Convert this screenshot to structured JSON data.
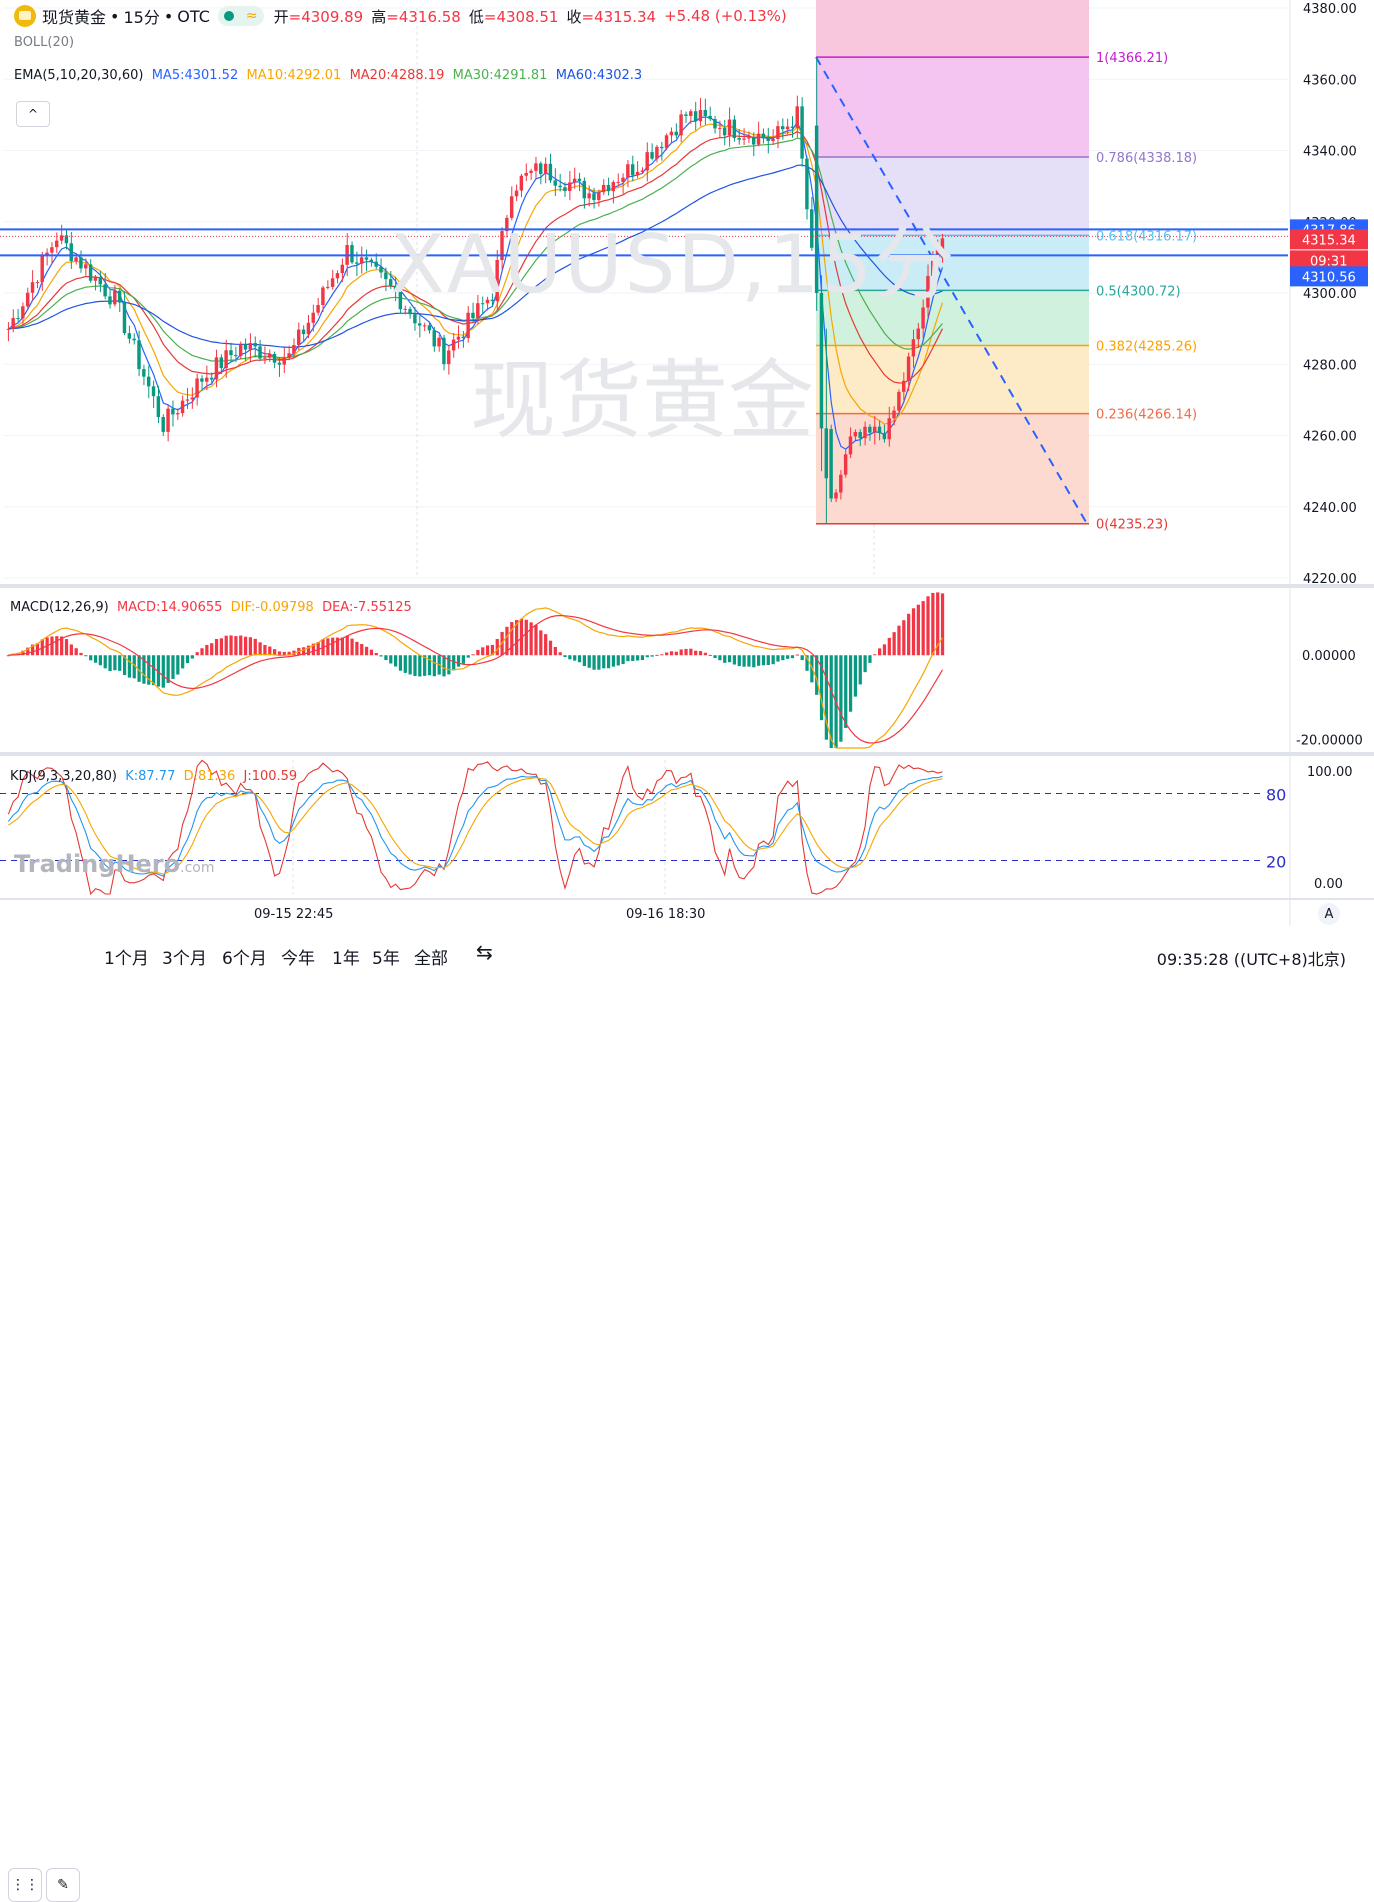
{
  "header": {
    "symbol_name": "现货黄金",
    "interval": "15分",
    "exchange": "OTC",
    "sep": "•",
    "wave_icon": "≈",
    "open_label": "开",
    "open": "=4309.89",
    "high_label": "高",
    "high": "=4316.58",
    "low_label": "低",
    "low": "=4308.51",
    "close_label": "收",
    "close": "=4315.34",
    "change": "+5.48 (+0.13%)"
  },
  "indicators": {
    "boll": "BOLL(20)",
    "ema": "EMA(5,10,20,30,60)",
    "ma5": "MA5:4301.52",
    "ma10": "MA10:4292.01",
    "ma20": "MA20:4288.19",
    "ma30": "MA30:4291.81",
    "ma60": "MA60:4302.3",
    "macd_title": "MACD(12,26,9)",
    "macd_val": "MACD:14.90655",
    "dif_val": "DIF:-0.09798",
    "dea_val": "DEA:-7.55125",
    "kdj_title": "KDJ(9,3,3,20,80)",
    "k_val": "K:87.77",
    "d_val": "D:81.36",
    "j_val": "J:100.59"
  },
  "colors": {
    "up": "#f23645",
    "down": "#089981",
    "ma5": "#2962ff",
    "ma10": "#f7a600",
    "ma20": "#e53935",
    "ma30": "#4caf50",
    "ma60": "#1e53e5",
    "macd": "#f23645",
    "dif": "#f7a600",
    "dea": "#f23645",
    "k": "#2196f3",
    "d": "#f7a600",
    "j": "#e53935"
  },
  "watermark": {
    "symbol": "XAUUSD,15分",
    "name": "现货黄金",
    "brand": "TradingHero",
    "brand_suffix": ".com"
  },
  "price_badges": {
    "p1": "4317.86",
    "p2": "4315.34",
    "countdown": "09:31",
    "p3": "4310.56"
  },
  "fib_levels": [
    {
      "label": "1(4366.21)",
      "price": 4366.21,
      "color": "#c51bd1",
      "fill": "#f2bbee"
    },
    {
      "label": "0.786(4338.18)",
      "price": 4338.18,
      "color": "#9575cd",
      "fill": "#e1d9f6"
    },
    {
      "label": "0.618(4316.17)",
      "price": 4316.17,
      "color": "#4fc3f7",
      "fill": "#c0e9f5"
    },
    {
      "label": "0.5(4300.72)",
      "price": 4300.72,
      "color": "#26a69a",
      "fill": "#c8eed8"
    },
    {
      "label": "0.382(4285.26)",
      "price": 4285.26,
      "color": "#ffa000",
      "fill": "#fde7bd"
    },
    {
      "label": "0.236(4266.14)",
      "price": 4266.14,
      "color": "#ef6c45",
      "fill": "#fcd3c8"
    },
    {
      "label": "0(4235.23)",
      "price": 4235.23,
      "color": "#e53935",
      "fill": ""
    }
  ],
  "fib_top_fill": "#f8c4dc",
  "chart_data": [
    {
      "type": "candlestick",
      "title": "现货黄金 • 15分 • OTC",
      "y_axis_ticks": [
        "4220.00",
        "4240.00",
        "4260.00",
        "4280.00",
        "4300.00",
        "4320.00",
        "4340.00",
        "4360.00",
        "4380.00"
      ],
      "ylim": [
        4220,
        4380
      ],
      "x_tick_labels": [
        "09-15 22:45",
        "09-16 18:30"
      ],
      "last": {
        "open": 4309.89,
        "high": 4316.58,
        "low": 4308.51,
        "close": 4315.34
      },
      "horizontal_lines": [
        4317.86,
        4310.56
      ],
      "key_points": [
        {
          "bar": 0,
          "price": 4290
        },
        {
          "bar": 10,
          "price": 4316
        },
        {
          "bar": 22,
          "price": 4298
        },
        {
          "bar": 32,
          "price": 4263
        },
        {
          "bar": 40,
          "price": 4276
        },
        {
          "bar": 48,
          "price": 4285
        },
        {
          "bar": 58,
          "price": 4282
        },
        {
          "bar": 70,
          "price": 4312
        },
        {
          "bar": 80,
          "price": 4300
        },
        {
          "bar": 90,
          "price": 4283
        },
        {
          "bar": 100,
          "price": 4300
        },
        {
          "bar": 104,
          "price": 4330
        },
        {
          "bar": 110,
          "price": 4335
        },
        {
          "bar": 120,
          "price": 4328
        },
        {
          "bar": 130,
          "price": 4336
        },
        {
          "bar": 140,
          "price": 4350
        },
        {
          "bar": 150,
          "price": 4346
        },
        {
          "bar": 158,
          "price": 4343
        },
        {
          "bar": 163,
          "price": 4350
        },
        {
          "bar": 167,
          "price": 4297
        },
        {
          "bar": 170,
          "price": 4240
        },
        {
          "bar": 174,
          "price": 4258
        },
        {
          "bar": 182,
          "price": 4262
        },
        {
          "bar": 188,
          "price": 4290
        },
        {
          "bar": 192,
          "price": 4315
        }
      ]
    },
    {
      "type": "bar+line",
      "title": "MACD(12,26,9)",
      "y_axis_ticks": [
        "0.00000",
        "-20.00000"
      ],
      "ylim": [
        -22,
        15
      ],
      "series": [
        {
          "name": "MACD",
          "kind": "histogram",
          "last": 14.90655
        },
        {
          "name": "DIF",
          "kind": "line",
          "last": -0.09798
        },
        {
          "name": "DEA",
          "kind": "line",
          "last": -7.55125
        }
      ]
    },
    {
      "type": "line",
      "title": "KDJ(9,3,3,20,80)",
      "y_axis_ticks": [
        "100.00",
        "0.00"
      ],
      "ylim": [
        -10,
        110
      ],
      "reference_lines": [
        {
          "value": 80,
          "label": "80"
        },
        {
          "value": 20,
          "label": "20"
        }
      ],
      "series": [
        {
          "name": "K",
          "last": 87.77
        },
        {
          "name": "D",
          "last": 81.36
        },
        {
          "name": "J",
          "last": 100.59
        }
      ]
    }
  ],
  "bottom_bar": {
    "ranges": [
      "1个月",
      "3个月",
      "6个月",
      "今年",
      "1年",
      "5年",
      "全部"
    ],
    "clock": "09:35:28 ((UTC+8)北京)",
    "auto": "A",
    "collapse": "^"
  }
}
